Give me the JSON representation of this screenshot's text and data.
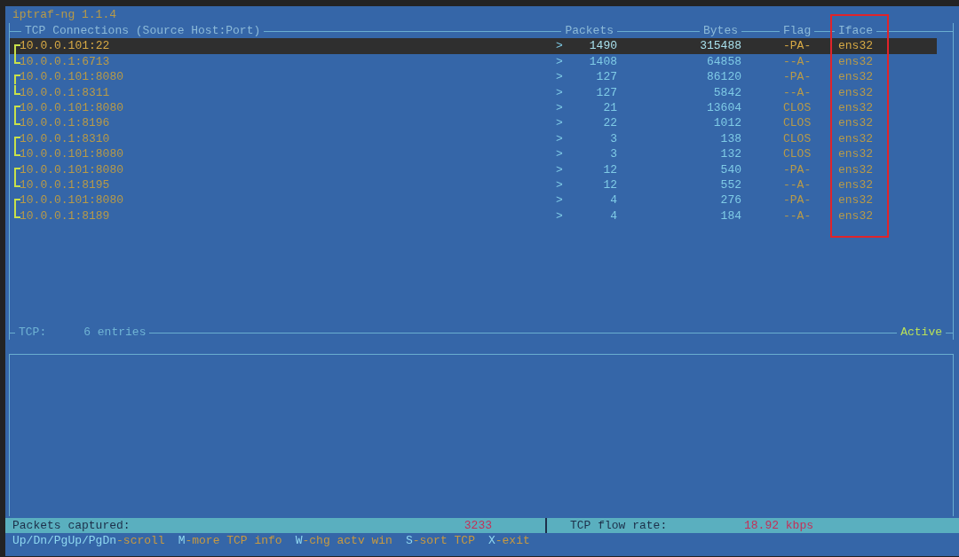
{
  "title": "iptraf-ng 1.1.4",
  "tcp_panel": {
    "headers": {
      "connections": "TCP Connections (Source Host:Port)",
      "packets": "Packets",
      "bytes": "Bytes",
      "flag": "Flag",
      "iface": "Iface"
    },
    "connections": [
      {
        "endpoints": [
          {
            "address": "10.0.0.101:22",
            "dir": ">",
            "packets": "1490",
            "bytes": "315488",
            "flag": "-PA-",
            "iface": "ens32",
            "selected": true
          },
          {
            "address": "10.0.0.1:6713",
            "dir": ">",
            "packets": "1408",
            "bytes": "64858",
            "flag": "--A-",
            "iface": "ens32",
            "selected": false
          }
        ]
      },
      {
        "endpoints": [
          {
            "address": "10.0.0.101:8080",
            "dir": ">",
            "packets": "127",
            "bytes": "86120",
            "flag": "-PA-",
            "iface": "ens32",
            "selected": false
          },
          {
            "address": "10.0.0.1:8311",
            "dir": ">",
            "packets": "127",
            "bytes": "5842",
            "flag": "--A-",
            "iface": "ens32",
            "selected": false
          }
        ]
      },
      {
        "endpoints": [
          {
            "address": "10.0.0.101:8080",
            "dir": ">",
            "packets": "21",
            "bytes": "13604",
            "flag": "CLOS",
            "iface": "ens32",
            "selected": false
          },
          {
            "address": "10.0.0.1:8196",
            "dir": ">",
            "packets": "22",
            "bytes": "1012",
            "flag": "CLOS",
            "iface": "ens32",
            "selected": false
          }
        ]
      },
      {
        "endpoints": [
          {
            "address": "10.0.0.1:8310",
            "dir": ">",
            "packets": "3",
            "bytes": "138",
            "flag": "CLOS",
            "iface": "ens32",
            "selected": false
          },
          {
            "address": "10.0.0.101:8080",
            "dir": ">",
            "packets": "3",
            "bytes": "132",
            "flag": "CLOS",
            "iface": "ens32",
            "selected": false
          }
        ]
      },
      {
        "endpoints": [
          {
            "address": "10.0.0.101:8080",
            "dir": ">",
            "packets": "12",
            "bytes": "540",
            "flag": "-PA-",
            "iface": "ens32",
            "selected": false
          },
          {
            "address": "10.0.0.1:8195",
            "dir": ">",
            "packets": "12",
            "bytes": "552",
            "flag": "--A-",
            "iface": "ens32",
            "selected": false
          }
        ]
      },
      {
        "endpoints": [
          {
            "address": "10.0.0.101:8080",
            "dir": ">",
            "packets": "4",
            "bytes": "276",
            "flag": "-PA-",
            "iface": "ens32",
            "selected": false
          },
          {
            "address": "10.0.0.1:8189",
            "dir": ">",
            "packets": "4",
            "bytes": "184",
            "flag": "--A-",
            "iface": "ens32",
            "selected": false
          }
        ]
      }
    ],
    "footer": {
      "label": "TCP:",
      "entries": "6 entries",
      "status": "Active"
    }
  },
  "status_bar": {
    "packets_label": "Packets captured:",
    "packets_value": "3233",
    "rate_label": "TCP flow rate:",
    "rate_value": "18.92 kbps"
  },
  "key_hints": [
    {
      "key": "Up/Dn/PgUp/PgDn",
      "action": "-scroll"
    },
    {
      "key": "M",
      "action": "-more TCP info"
    },
    {
      "key": "W",
      "action": "-chg actv win"
    },
    {
      "key": "S",
      "action": "-sort TCP"
    },
    {
      "key": "X",
      "action": "-exit"
    }
  ]
}
